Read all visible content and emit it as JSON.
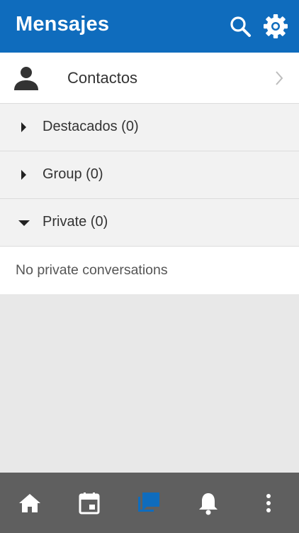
{
  "header": {
    "title": "Mensajes",
    "background": "#0f6cbd",
    "icons": [
      "search-icon",
      "settings-gear-icon"
    ]
  },
  "contacts": {
    "label": "Contactos",
    "icon": "person-icon",
    "trailing_icon": "chevron-right-icon"
  },
  "sections": [
    {
      "label": "Destacados (0)",
      "expanded": false
    },
    {
      "label": "Group (0)",
      "expanded": false
    },
    {
      "label": "Private (0)",
      "expanded": true
    }
  ],
  "private_empty_text": "No private conversations",
  "bottom_nav": {
    "items": [
      {
        "icon": "home-icon",
        "active": false
      },
      {
        "icon": "calendar-icon",
        "active": false
      },
      {
        "icon": "messages-icon",
        "active": true
      },
      {
        "icon": "bell-icon",
        "active": false
      },
      {
        "icon": "more-vertical-icon",
        "active": false
      }
    ],
    "active_color": "#0f6cbd",
    "inactive_color": "#ffffff"
  }
}
